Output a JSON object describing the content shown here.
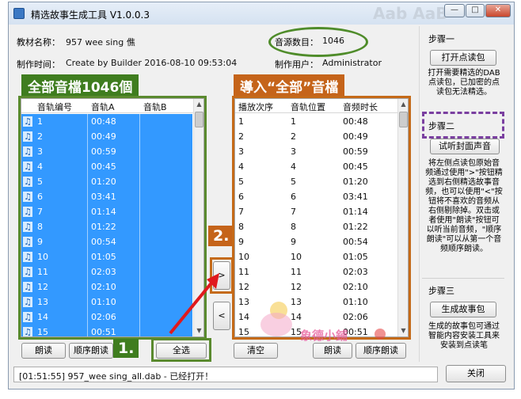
{
  "window": {
    "title": "精选故事生成工具 V1.0.0.3",
    "ghost_text": "Aab AaB",
    "buttons": [
      "—",
      "□",
      "✕"
    ]
  },
  "header": {
    "material_name_label": "教材名称：",
    "material_name_value": "957 wee sing  僬",
    "created_label": "制作时间：",
    "created_value": "Create by Builder 2016-08-10 09:53:04",
    "count_label": "音源数目：",
    "count_value": "1046",
    "user_label": "制作用户：",
    "user_value": "Administrator"
  },
  "annotations": {
    "left_label": "全部音檔1046個",
    "right_label": "導入“全部”音檔",
    "step1_num": "1.",
    "step2_num": "2."
  },
  "left_table": {
    "headers": [
      "音轨编号",
      "音轨A",
      "音轨B"
    ],
    "rows": [
      {
        "no": "1",
        "a": "00:48"
      },
      {
        "no": "2",
        "a": "00:49"
      },
      {
        "no": "3",
        "a": "00:59"
      },
      {
        "no": "4",
        "a": "00:45"
      },
      {
        "no": "5",
        "a": "01:20"
      },
      {
        "no": "6",
        "a": "03:41"
      },
      {
        "no": "7",
        "a": "01:14"
      },
      {
        "no": "8",
        "a": "01:22"
      },
      {
        "no": "9",
        "a": "00:54"
      },
      {
        "no": "10",
        "a": "01:05"
      },
      {
        "no": "11",
        "a": "02:03"
      },
      {
        "no": "12",
        "a": "02:10"
      },
      {
        "no": "13",
        "a": "01:10"
      },
      {
        "no": "14",
        "a": "02:06"
      },
      {
        "no": "15",
        "a": "00:51"
      }
    ]
  },
  "right_table": {
    "headers": [
      "播放次序",
      "音轨位置",
      "音频时长"
    ],
    "rows": [
      {
        "order": "1",
        "pos": "1",
        "dur": "00:48"
      },
      {
        "order": "2",
        "pos": "2",
        "dur": "00:49"
      },
      {
        "order": "3",
        "pos": "3",
        "dur": "00:59"
      },
      {
        "order": "4",
        "pos": "4",
        "dur": "00:45"
      },
      {
        "order": "5",
        "pos": "5",
        "dur": "01:20"
      },
      {
        "order": "6",
        "pos": "6",
        "dur": "03:41"
      },
      {
        "order": "7",
        "pos": "7",
        "dur": "01:14"
      },
      {
        "order": "8",
        "pos": "8",
        "dur": "01:22"
      },
      {
        "order": "9",
        "pos": "9",
        "dur": "00:54"
      },
      {
        "order": "10",
        "pos": "10",
        "dur": "01:05"
      },
      {
        "order": "11",
        "pos": "11",
        "dur": "02:03"
      },
      {
        "order": "12",
        "pos": "12",
        "dur": "02:10"
      },
      {
        "order": "13",
        "pos": "13",
        "dur": "01:10"
      },
      {
        "order": "14",
        "pos": "14",
        "dur": "02:06"
      },
      {
        "order": "15",
        "pos": "15",
        "dur": "00:51"
      }
    ]
  },
  "transfer": {
    "add": ">",
    "remove": "<"
  },
  "left_buttons": {
    "play": "朗读",
    "order_play": "顺序朗读",
    "select_all": "全选"
  },
  "right_buttons": {
    "clear": "清空",
    "play": "朗读",
    "order_play": "顺序朗读"
  },
  "sidebar": {
    "step1_title": "步骤一",
    "open_button": "打开点读包",
    "step1_desc": "打开需要精选的DAB点读包，已加密的点读包无法精选。",
    "step2_title": "步骤二",
    "listen_button": "试听封面声音",
    "step2_desc": "将左侧点读包原始音频通过使用\">\"按钮精选到右侧精选故事音频，也可以使用\"<\"按钮将不喜欢的音频从右侧剔除掉。双击或者使用\"朗读\"按钮可以听当前音频，\"顺序朗读\"可以从第一个音频顺序朗读。",
    "step3_title": "步骤三",
    "generate_button": "生成故事包",
    "step3_desc": "生成的故事包可通过智能内容安装工具来安装到点读笔",
    "close_button": "关闭"
  },
  "status": "[01:51:55] 957_wee sing_all.dab - 已经打开！",
  "watermark": "象德小鋪",
  "colors": {
    "selection": "#3399ff",
    "green": "#3f7d1f",
    "orange": "#c5641a",
    "purple": "#7a3fa0",
    "arrow": "#e0191d"
  }
}
